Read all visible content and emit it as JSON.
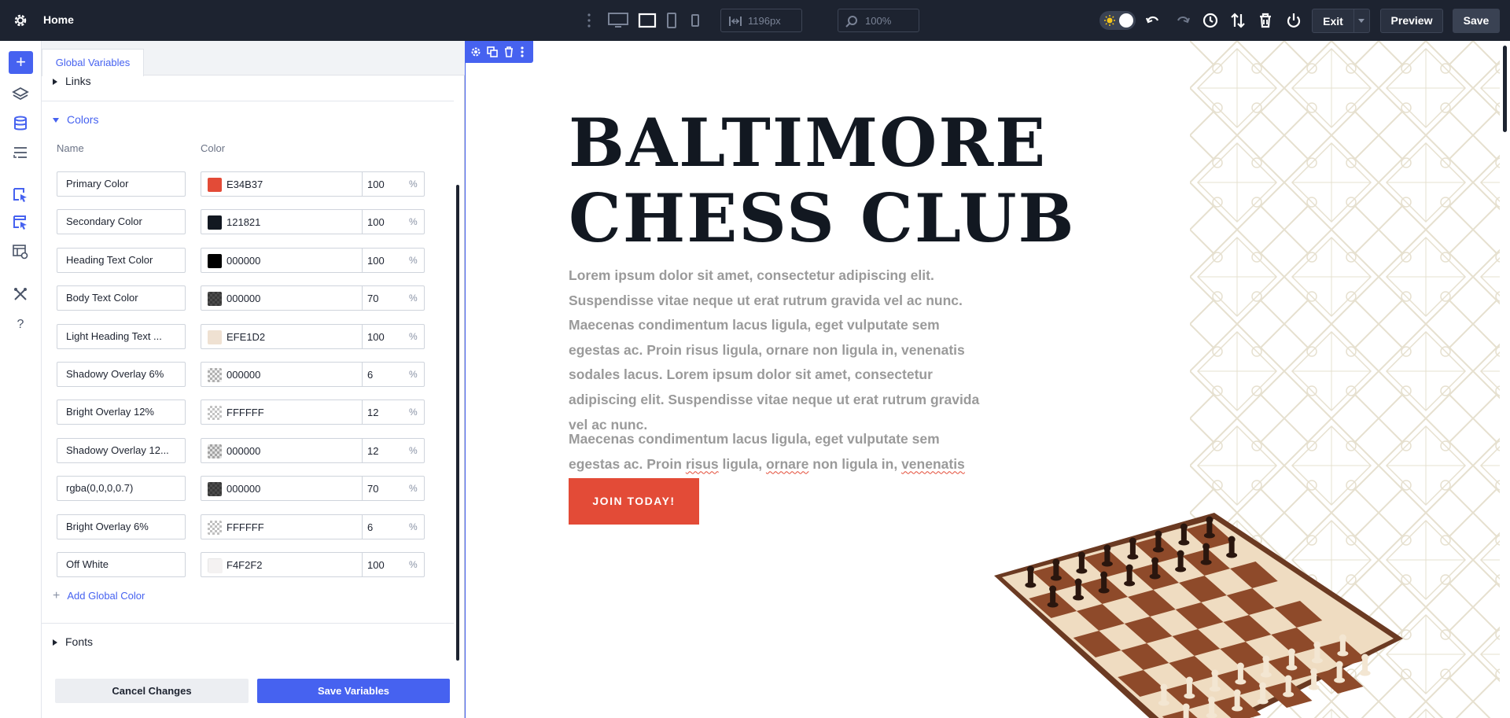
{
  "topbar": {
    "page_name": "Home",
    "width_value": "1196px",
    "zoom_value": "100%",
    "exit_label": "Exit",
    "preview_label": "Preview",
    "save_label": "Save"
  },
  "panel": {
    "tab_label": "Global Variables",
    "links_label": "Links",
    "colors_label": "Colors",
    "fonts_label": "Fonts",
    "col_name": "Name",
    "col_color": "Color",
    "pct_symbol": "%",
    "add_color_label": "Add Global Color",
    "cancel_label": "Cancel Changes",
    "save_label": "Save Variables",
    "colors": [
      {
        "name": "Primary Color",
        "hex": "E34B37",
        "opacity": "100",
        "swatch": "#E34B37"
      },
      {
        "name": "Secondary Color",
        "hex": "121821",
        "opacity": "100",
        "swatch": "#121821"
      },
      {
        "name": "Heading Text Color",
        "hex": "000000",
        "opacity": "100",
        "swatch": "#000000"
      },
      {
        "name": "Body Text Color",
        "hex": "000000",
        "opacity": "70",
        "swatch": "rgba(0,0,0,0.7)"
      },
      {
        "name": "Light Heading Text ...",
        "hex": "EFE1D2",
        "opacity": "100",
        "swatch": "#EFE1D2"
      },
      {
        "name": "Shadowy Overlay 6%",
        "hex": "000000",
        "opacity": "6",
        "swatch": "rgba(0,0,0,0.06)"
      },
      {
        "name": "Bright Overlay 12%",
        "hex": "FFFFFF",
        "opacity": "12",
        "swatch": "rgba(255,255,255,0.12)"
      },
      {
        "name": "Shadowy Overlay 12...",
        "hex": "000000",
        "opacity": "12",
        "swatch": "rgba(0,0,0,0.12)"
      },
      {
        "name": "rgba(0,0,0,0.7)",
        "hex": "000000",
        "opacity": "70",
        "swatch": "rgba(0,0,0,0.7)"
      },
      {
        "name": "Bright Overlay 6%",
        "hex": "FFFFFF",
        "opacity": "6",
        "swatch": "rgba(255,255,255,0.06)"
      },
      {
        "name": "Off White",
        "hex": "F4F2F2",
        "opacity": "100",
        "swatch": "#F4F2F2"
      }
    ]
  },
  "canvas": {
    "title_line1": "BALTIMORE",
    "title_line2": "CHESS CLUB",
    "para1": "Lorem ipsum dolor sit amet, consectetur adipiscing elit. Suspendisse vitae neque ut erat rutrum gravida vel ac nunc. Maecenas condimentum lacus ligula, eget vulputate sem egestas ac. Proin risus ligula, ornare non ligula in, venenatis sodales lacus. Lorem ipsum dolor sit amet, consectetur adipiscing elit. Suspendisse vitae neque ut erat rutrum gravida vel ac nunc.",
    "para2_a": "Maecenas condimentum lacus ligula, eget vulputate sem egestas ac. Proin ",
    "para2_b": "risus",
    "para2_c": " ligula, ",
    "para2_d": "ornare",
    "para2_e": " non ligula in, ",
    "para2_f": "venenatis sodales lacus.",
    "cta_label": "JOIN TODAY!"
  },
  "colors": {
    "topbar_bg": "#1d2330",
    "accent": "#4662f0",
    "brand_primary": "#e34b37",
    "brand_secondary": "#121821",
    "pattern_line": "#e6e0cf"
  }
}
